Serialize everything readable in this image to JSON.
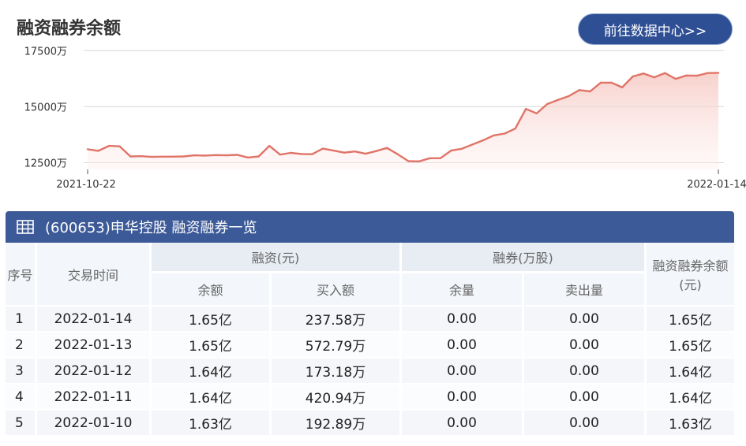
{
  "page": {
    "title": "融资融券余额",
    "goto_button": "前往数据中心>>"
  },
  "chart_data": {
    "type": "area",
    "title": "融资融券余额",
    "x_start": "2021-10-22",
    "x_end": "2022-01-14",
    "x_tick_labels": [
      "2021-10-22",
      "2022-01-14"
    ],
    "y_tick_labels": [
      "17500万",
      "15000万",
      "12500万"
    ],
    "y_ticks": [
      17500,
      15000,
      12500
    ],
    "ylim": [
      12200,
      17650
    ],
    "grid": true,
    "color": "#e07468",
    "series": [
      {
        "unit": "万",
        "values": [
          13100,
          13030,
          13250,
          13230,
          12780,
          12790,
          12760,
          12770,
          12770,
          12780,
          12830,
          12820,
          12840,
          12830,
          12850,
          12730,
          12780,
          13250,
          12860,
          12940,
          12890,
          12880,
          13130,
          13040,
          12950,
          13000,
          12900,
          13020,
          13160,
          12880,
          12570,
          12560,
          12700,
          12700,
          13040,
          13120,
          13310,
          13500,
          13720,
          13800,
          14020,
          14900,
          14700,
          15120,
          15300,
          15470,
          15740,
          15680,
          16070,
          16070,
          15860,
          16350,
          16480,
          16310,
          16500,
          16240,
          16390,
          16380,
          16500,
          16510
        ]
      }
    ]
  },
  "table": {
    "icon": "table-grid-icon",
    "title": "(600653)申华控股 融资融券一览",
    "headers": {
      "index": "序号",
      "date": "交易时间",
      "financing": "融资(元)",
      "securities_lending": "融券(万股)",
      "total": "融资融券余额(元)",
      "balance": "余额",
      "buy": "买入额",
      "remaining": "余量",
      "sell": "卖出量"
    },
    "rows": [
      {
        "index": "1",
        "date": "2022-01-14",
        "balance": "1.65亿",
        "buy": "237.58万",
        "remaining": "0.00",
        "sell": "0.00",
        "total": "1.65亿"
      },
      {
        "index": "2",
        "date": "2022-01-13",
        "balance": "1.65亿",
        "buy": "572.79万",
        "remaining": "0.00",
        "sell": "0.00",
        "total": "1.65亿"
      },
      {
        "index": "3",
        "date": "2022-01-12",
        "balance": "1.64亿",
        "buy": "173.18万",
        "remaining": "0.00",
        "sell": "0.00",
        "total": "1.64亿"
      },
      {
        "index": "4",
        "date": "2022-01-11",
        "balance": "1.64亿",
        "buy": "420.94万",
        "remaining": "0.00",
        "sell": "0.00",
        "total": "1.64亿"
      },
      {
        "index": "5",
        "date": "2022-01-10",
        "balance": "1.63亿",
        "buy": "192.89万",
        "remaining": "0.00",
        "sell": "0.00",
        "total": "1.63亿"
      }
    ]
  }
}
